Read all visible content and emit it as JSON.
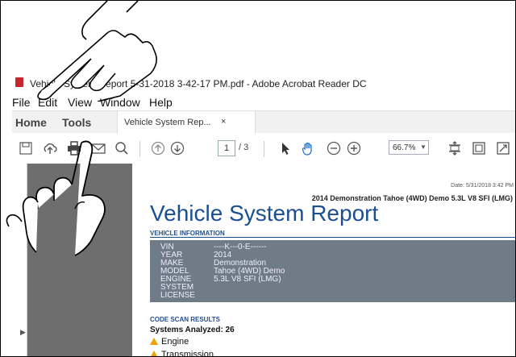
{
  "window": {
    "title": "Vehicle System Report 5-31-2018 3-42-17 PM.pdf - Adobe Acrobat Reader DC"
  },
  "menu": {
    "items": [
      "File",
      "Edit",
      "View",
      "Window",
      "Help"
    ]
  },
  "tabs": {
    "home": "Home",
    "tools": "Tools",
    "document": "Vehicle System Rep...",
    "close": "×"
  },
  "toolbar": {
    "icons": [
      "save-icon",
      "upload-icon",
      "print-icon",
      "email-icon",
      "search-icon",
      "page-up-icon",
      "page-down-icon",
      "select-pointer-icon",
      "hand-tool-icon",
      "zoom-out-icon",
      "zoom-in-icon",
      "fit-page-icon",
      "scroll-mode-icon",
      "fullscreen-icon"
    ],
    "page_current": "1",
    "page_total": "/ 3",
    "zoom": "66.7%"
  },
  "document": {
    "date": "Date: 5/31/2018 3:42 PM",
    "subtitle": "2014 Demonstration Tahoe (4WD) Demo 5.3L V8 SFI (LMG)",
    "title": "Vehicle System Report",
    "vehicle_info_heading": "VEHICLE INFORMATION",
    "vehicle_info": [
      {
        "key": "VIN",
        "value": "----K---0-E------"
      },
      {
        "key": "YEAR",
        "value": "2014"
      },
      {
        "key": "MAKE",
        "value": "Demonstration"
      },
      {
        "key": "MODEL",
        "value": "Tahoe (4WD) Demo"
      },
      {
        "key": "ENGINE",
        "value": "5.3L V8 SFI (LMG)"
      },
      {
        "key": "SYSTEM",
        "value": ""
      },
      {
        "key": "LICENSE",
        "value": ""
      }
    ],
    "code_scan_heading": "CODE SCAN RESULTS",
    "systems_analyzed": "Systems Analyzed: 26",
    "systems": [
      "Engine",
      "Transmission"
    ]
  },
  "colors": {
    "title_blue": "#1b4f8f",
    "info_box": "#6f7b87",
    "warning": "#f0a000",
    "gutter": "#6e6e6e"
  }
}
